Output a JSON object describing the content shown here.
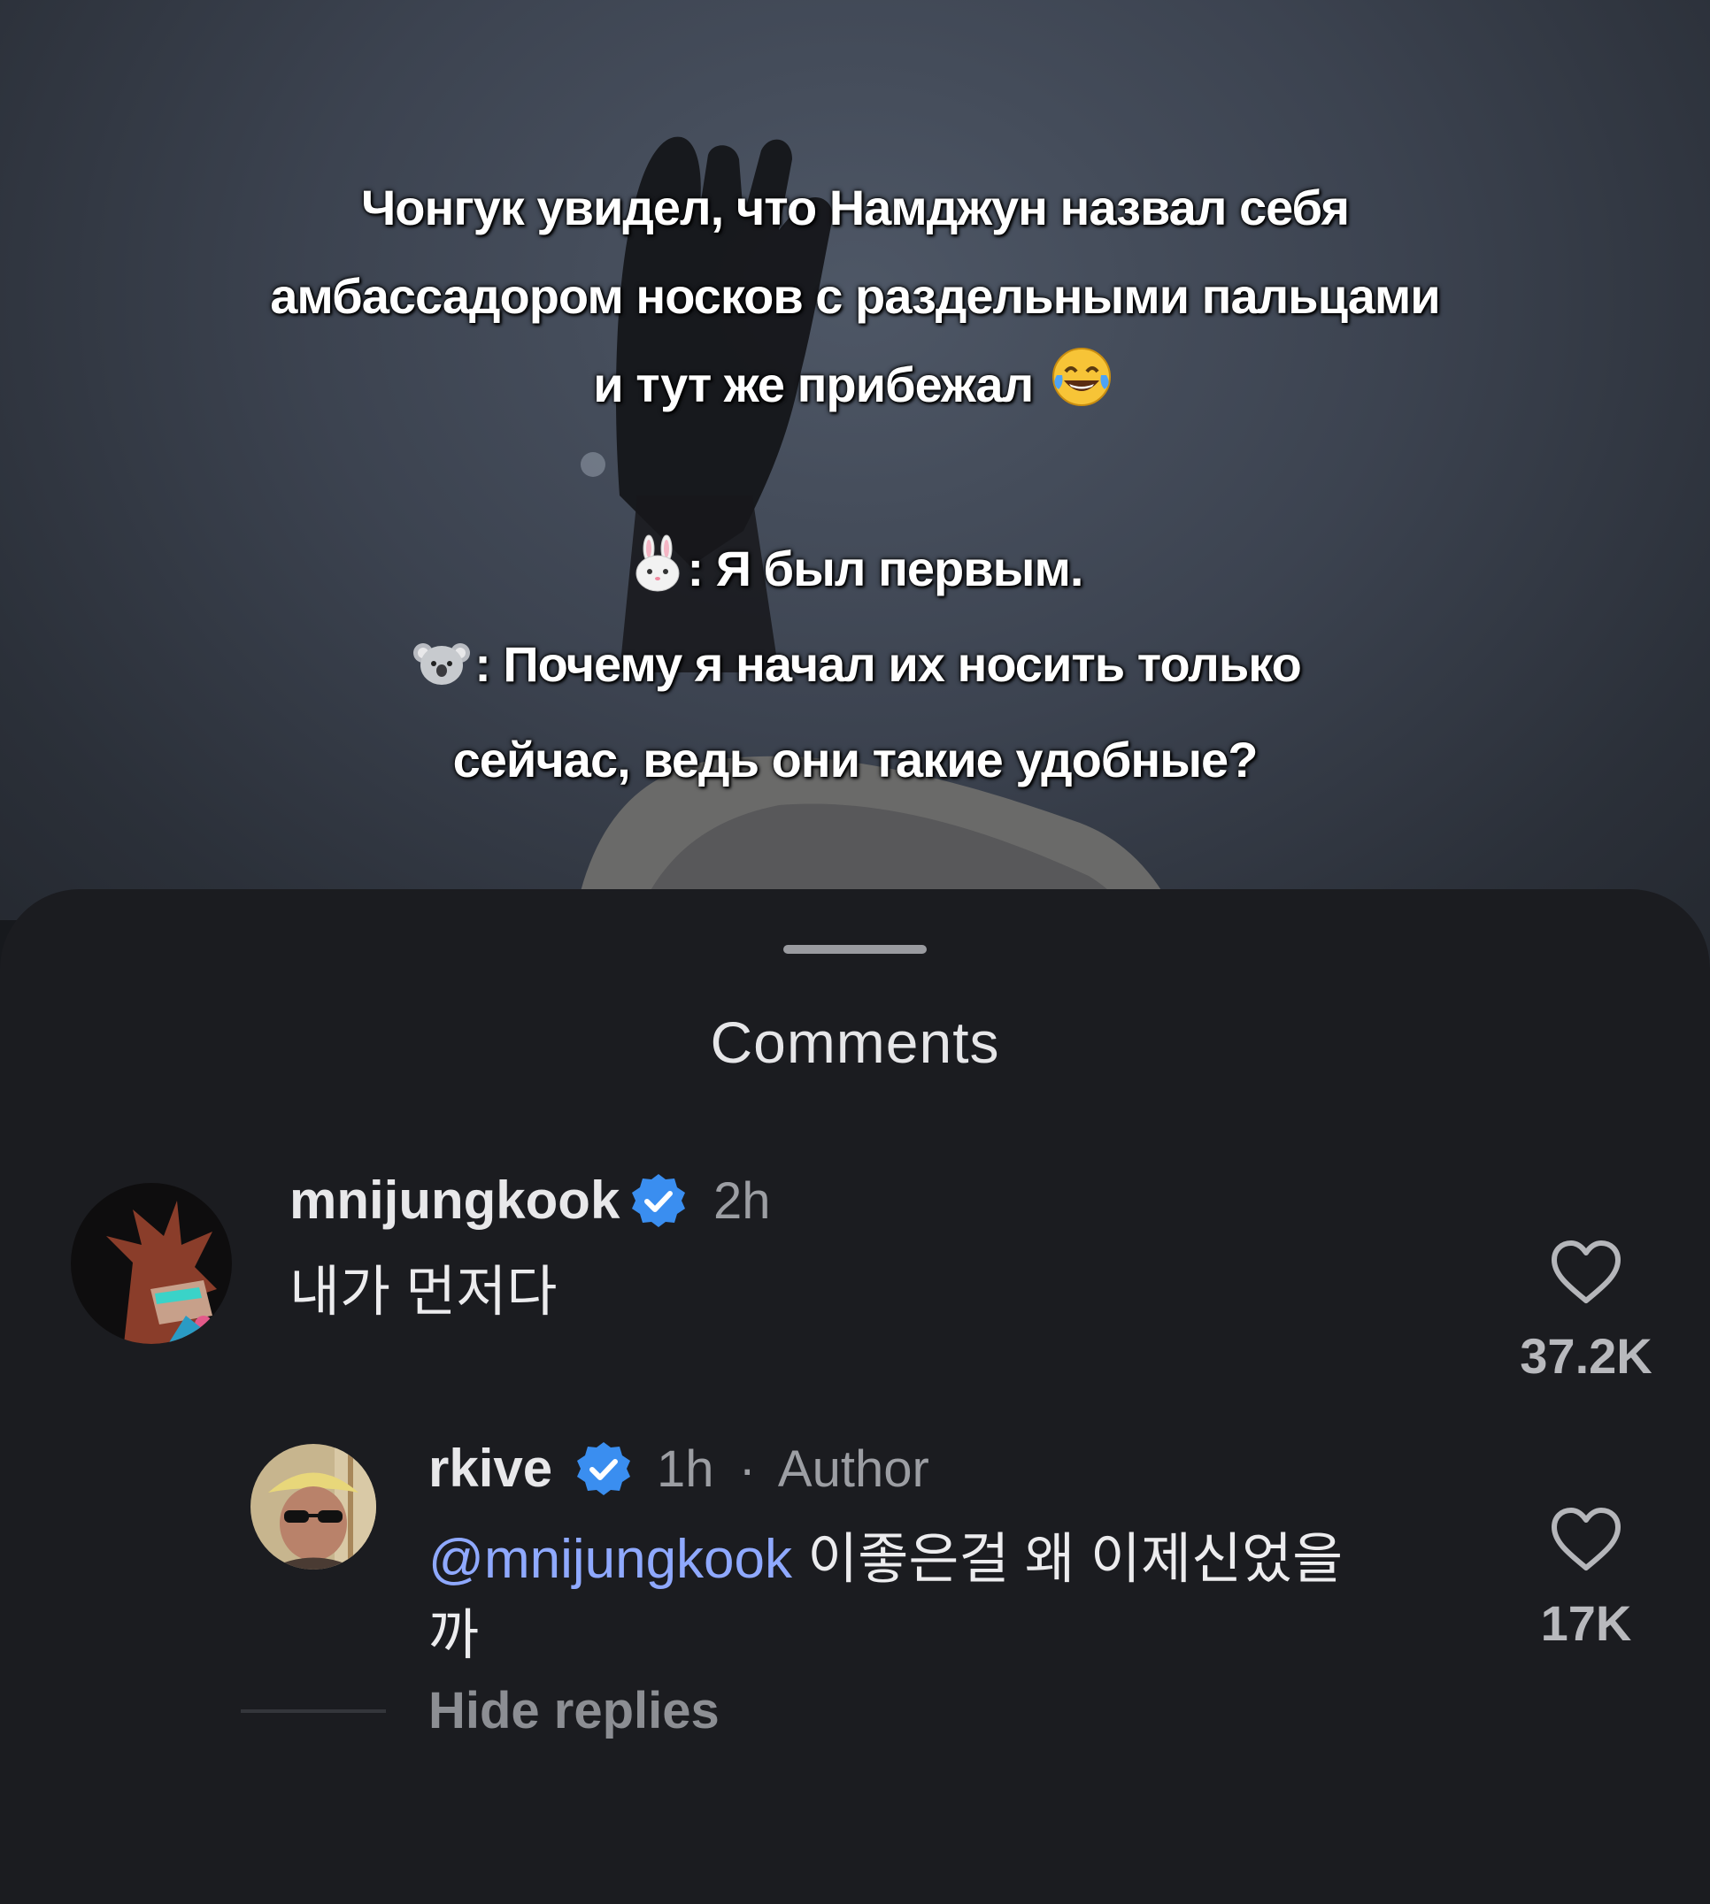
{
  "caption": {
    "line1": "Чонгук увидел, что Намджун назвал себя",
    "line2": "амбассадором носков с раздельными пальцами",
    "line3": "и тут же прибежал",
    "line3_emoji": "😂",
    "line4_emoji": "🐰",
    "line4": ": Я был первым.",
    "line5_emoji": "🐨",
    "line5": ": Почему я начал их носить только",
    "line6": "сейчас, ведь они такие удобные?"
  },
  "sheet": {
    "title": "Comments"
  },
  "comments": [
    {
      "username": "mnijungkook",
      "verified": true,
      "time": "2h",
      "text": "내가 먼저다",
      "likes": "37.2K",
      "avatar_icon": "anime-avatar"
    }
  ],
  "replies": [
    {
      "username": "rkive",
      "verified": true,
      "time": "1h",
      "separator": "·",
      "author_label": "Author",
      "mention": "@mnijungkook",
      "text_line1": " 이좋은걸 왜 이제신었을",
      "text_line2": "까",
      "likes": "17K",
      "avatar_icon": "person-photo-avatar"
    }
  ],
  "hide_replies_label": "Hide replies",
  "colors": {
    "background": "#1b1c20",
    "verified_blue": "#3a8ef0",
    "mention": "#8fa9ff"
  },
  "icons": [
    "heart-outline-icon",
    "verified-badge-icon"
  ]
}
